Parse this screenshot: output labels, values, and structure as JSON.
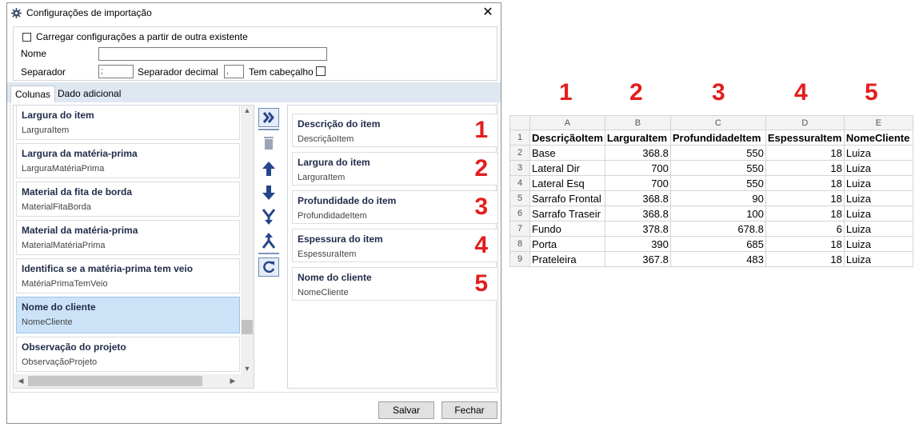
{
  "dialog": {
    "title": "Configurações de importação",
    "load_existing_label": "Carregar configurações a partir de outra existente",
    "name_label": "Nome",
    "name_value": "",
    "separator_label": "Separador",
    "separator_value": ";",
    "decimal_label": "Separador decimal",
    "decimal_value": ",",
    "header_label": "Tem cabeçalho",
    "tabs": [
      "Colunas",
      "Dado adicional"
    ],
    "save_label": "Salvar",
    "close_label": "Fechar"
  },
  "available_columns": [
    {
      "title": "Largura do item",
      "sub": "LarguraItem"
    },
    {
      "title": "Largura da matéria-prima",
      "sub": "LarguraMatériaPrima"
    },
    {
      "title": "Material da fita de borda",
      "sub": "MaterialFitaBorda"
    },
    {
      "title": "Material da matéria-prima",
      "sub": "MaterialMatériaPrima"
    },
    {
      "title": "Identifica se a matéria-prima tem veio",
      "sub": "MatériaPrimaTemVeio"
    },
    {
      "title": "Nome do cliente",
      "sub": "NomeCliente"
    },
    {
      "title": "Observação do projeto",
      "sub": "ObservaçãoProjeto"
    }
  ],
  "selected_columns": [
    {
      "title": "Descrição do item",
      "sub": "DescriçãoItem",
      "num": "1"
    },
    {
      "title": "Largura do item",
      "sub": "LarguraItem",
      "num": "2"
    },
    {
      "title": "Profundidade do item",
      "sub": "ProfundidadeItem",
      "num": "3"
    },
    {
      "title": "Espessura do item",
      "sub": "EspessuraItem",
      "num": "4"
    },
    {
      "title": "Nome do cliente",
      "sub": "NomeCliente",
      "num": "5"
    }
  ],
  "spreadsheet": {
    "column_numbers": [
      "1",
      "2",
      "3",
      "4",
      "5"
    ],
    "col_letters": [
      "A",
      "B",
      "C",
      "D",
      "E"
    ],
    "header_row": [
      "DescriçãoItem",
      "LarguraItem",
      "ProfundidadeItem",
      "EspessuraItem",
      "NomeCliente"
    ],
    "rows": [
      [
        "Base",
        "368.8",
        "550",
        "18",
        "Luiza"
      ],
      [
        "Lateral Dir",
        "700",
        "550",
        "18",
        "Luiza"
      ],
      [
        "Lateral Esq",
        "700",
        "550",
        "18",
        "Luiza"
      ],
      [
        "Sarrafo Frontal",
        "368.8",
        "90",
        "18",
        "Luiza"
      ],
      [
        "Sarrafo Traseir",
        "368.8",
        "100",
        "18",
        "Luiza"
      ],
      [
        "Fundo",
        "378.8",
        "678.8",
        "6",
        "Luiza"
      ],
      [
        "Porta",
        "390",
        "685",
        "18",
        "Luiza"
      ],
      [
        "Prateleira",
        "367.8",
        "483",
        "18",
        "Luiza"
      ]
    ],
    "row_numbers": [
      "1",
      "2",
      "3",
      "4",
      "5",
      "6",
      "7",
      "8",
      "9"
    ]
  },
  "colors": {
    "accent_red": "#e31e1e",
    "selection_blue": "#cce3f7",
    "tab_strip": "#dfe7f1"
  }
}
